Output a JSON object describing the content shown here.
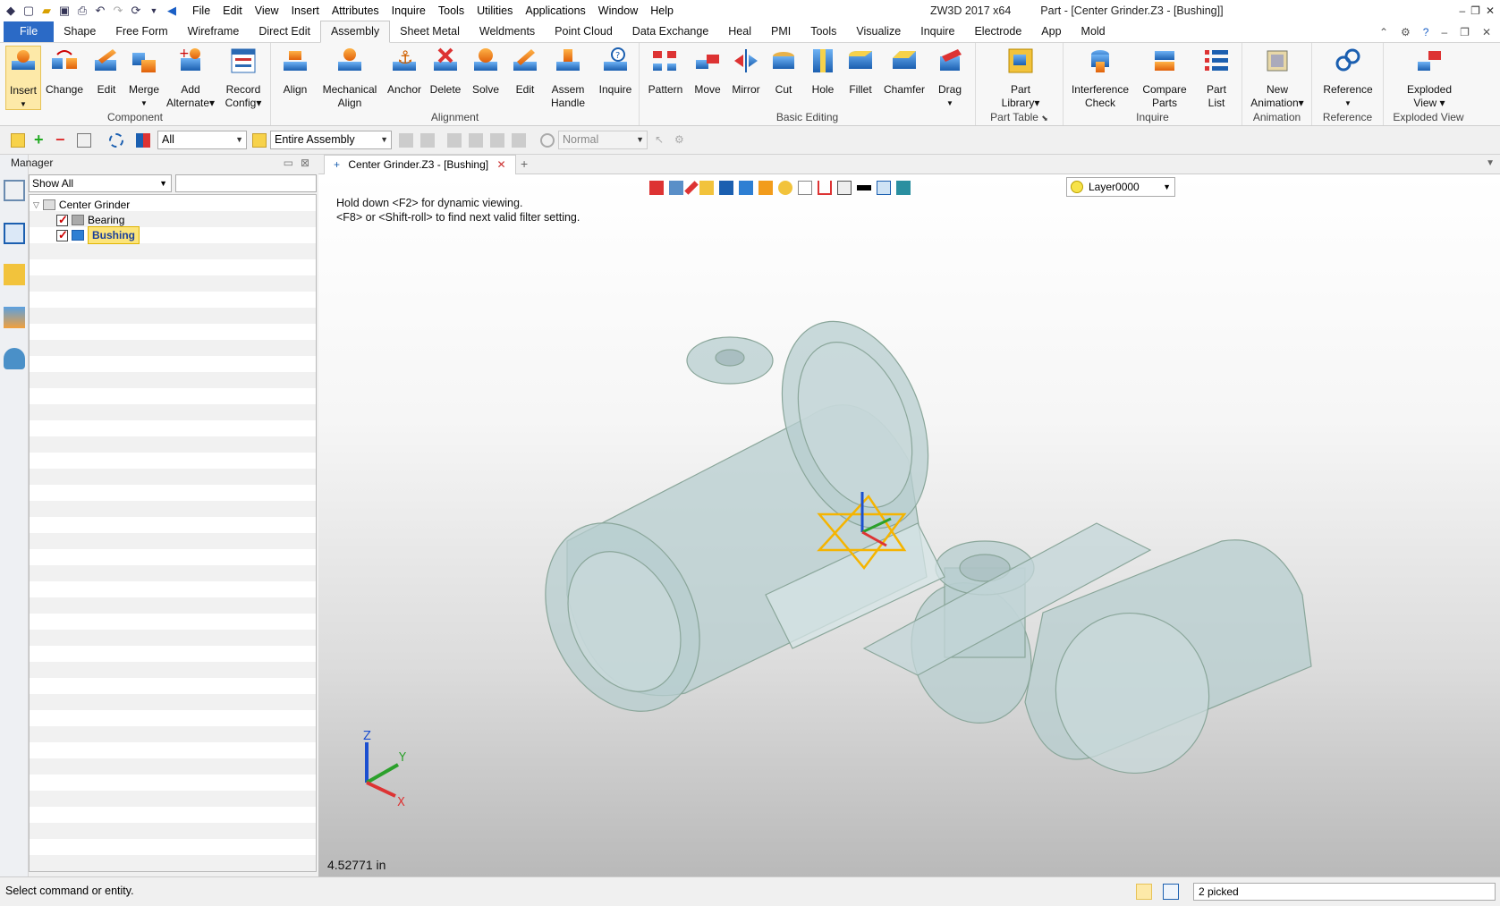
{
  "window": {
    "app_title": "ZW3D 2017  x64",
    "doc_title": "Part - [Center Grinder.Z3 - [Bushing]]"
  },
  "menu": [
    "File",
    "Edit",
    "View",
    "Insert",
    "Attributes",
    "Inquire",
    "Tools",
    "Utilities",
    "Applications",
    "Window",
    "Help"
  ],
  "ribbon_tabs": [
    "File",
    "Shape",
    "Free Form",
    "Wireframe",
    "Direct Edit",
    "Assembly",
    "Sheet Metal",
    "Weldments",
    "Point Cloud",
    "Data Exchange",
    "Heal",
    "PMI",
    "Tools",
    "Visualize",
    "Inquire",
    "Electrode",
    "App",
    "Mold"
  ],
  "active_tab": "Assembly",
  "groups": {
    "component": {
      "label": "Component",
      "buttons": [
        "Insert",
        "Change",
        "Edit",
        "Merge",
        "Add",
        "Alternate",
        "Record",
        "Config"
      ]
    },
    "alignment": {
      "label": "Alignment",
      "buttons": [
        "Align",
        "Mechanical",
        "Align",
        "Anchor",
        "Delete",
        "Solve",
        "Edit",
        "Assem",
        "Handle",
        "Inquire"
      ]
    },
    "basic": {
      "label": "Basic Editing",
      "buttons": [
        "Pattern",
        "Move",
        "Mirror",
        "Cut",
        "Hole",
        "Fillet",
        "Chamfer",
        "Drag"
      ]
    },
    "parttable": {
      "label": "Part Table",
      "buttons": [
        "Part",
        "Library"
      ]
    },
    "inquire": {
      "label": "Inquire",
      "buttons": [
        "Interference",
        "Check",
        "Compare",
        "Parts",
        "Part",
        "List"
      ]
    },
    "animation": {
      "label": "Animation",
      "buttons": [
        "New",
        "Animation"
      ]
    },
    "reference": {
      "label": "Reference",
      "buttons": [
        "Reference"
      ]
    },
    "exploded": {
      "label": "Exploded View",
      "buttons": [
        "Exploded",
        "View"
      ]
    }
  },
  "toolbar": {
    "filter": "All",
    "scope": "Entire Assembly",
    "mode": "Normal"
  },
  "manager": {
    "title": "Manager",
    "show_filter": "Show All",
    "tree": {
      "root": "Center Grinder",
      "children": [
        "Bearing",
        "Bushing"
      ],
      "selected": "Bushing"
    }
  },
  "doc_tab": "Center Grinder.Z3 - [Bushing]",
  "layer": "Layer0000",
  "hints": [
    "Hold down <F2> for dynamic viewing.",
    "<F8> or <Shift-roll> to find next valid filter setting."
  ],
  "distance": "4.52771 in",
  "axes": {
    "x": "X",
    "y": "Y",
    "z": "Z"
  },
  "status": {
    "message": "Select command or entity.",
    "picked": "2 picked"
  },
  "colors": {
    "accent": "#2b6ac6",
    "selection": "#f5b400",
    "model": "#b7cdcf"
  }
}
